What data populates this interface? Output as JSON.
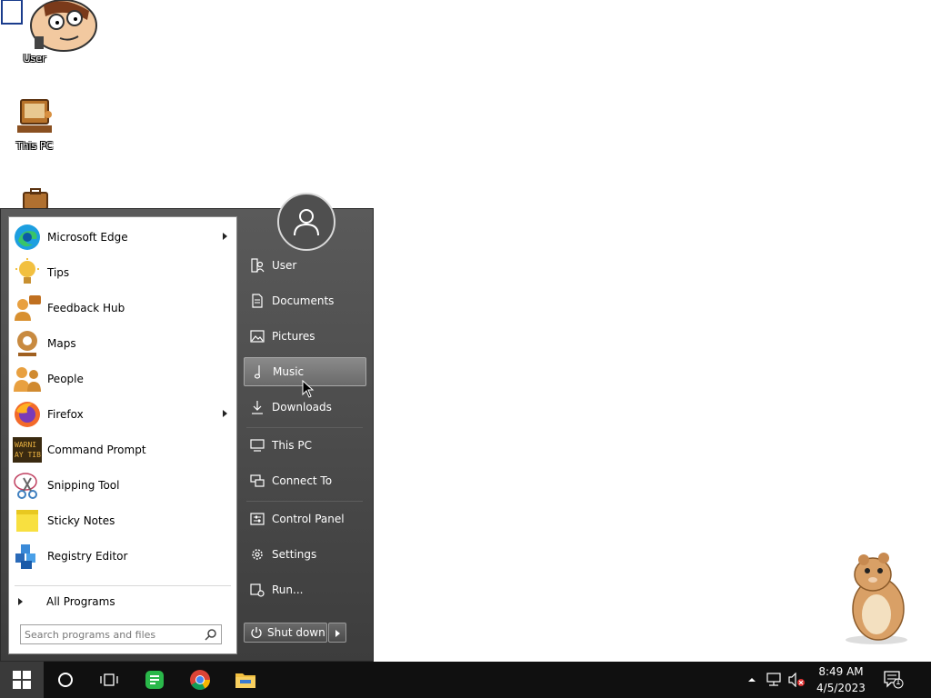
{
  "desktop": {
    "icons": [
      {
        "label": "User",
        "icon": "user-cartoon-icon"
      },
      {
        "label": "This PC",
        "icon": "computer-icon"
      },
      {
        "label": "",
        "icon": "briefcase-icon"
      }
    ]
  },
  "start_menu": {
    "programs": [
      {
        "label": "Microsoft Edge",
        "icon": "edge-icon",
        "submenu": true
      },
      {
        "label": "Tips",
        "icon": "lightbulb-icon",
        "submenu": false
      },
      {
        "label": "Feedback Hub",
        "icon": "feedback-icon",
        "submenu": false
      },
      {
        "label": "Maps",
        "icon": "maps-icon",
        "submenu": false
      },
      {
        "label": "People",
        "icon": "people-icon",
        "submenu": false
      },
      {
        "label": "Firefox",
        "icon": "firefox-icon",
        "submenu": true
      },
      {
        "label": "Command Prompt",
        "icon": "command-prompt-icon",
        "submenu": false
      },
      {
        "label": "Snipping Tool",
        "icon": "scissors-icon",
        "submenu": false
      },
      {
        "label": "Sticky Notes",
        "icon": "sticky-note-icon",
        "submenu": false
      },
      {
        "label": "Registry Editor",
        "icon": "registry-icon",
        "submenu": false
      }
    ],
    "all_programs_label": "All Programs",
    "search_placeholder": "Search programs and files",
    "places": [
      {
        "label": "User",
        "icon": "user-folder-icon"
      },
      {
        "label": "Documents",
        "icon": "document-icon"
      },
      {
        "label": "Pictures",
        "icon": "picture-icon"
      },
      {
        "label": "Music",
        "icon": "music-note-icon",
        "hover": true
      },
      {
        "label": "Downloads",
        "icon": "download-icon"
      },
      {
        "label": "This PC",
        "icon": "monitor-icon"
      },
      {
        "label": "Connect To",
        "icon": "connect-icon"
      },
      {
        "label": "Control Panel",
        "icon": "control-panel-icon"
      },
      {
        "label": "Settings",
        "icon": "gear-icon"
      },
      {
        "label": "Run...",
        "icon": "run-icon"
      }
    ],
    "shutdown_label": "Shut down"
  },
  "taskbar": {
    "pinned": [
      "windows-start-icon",
      "cortana-circle-icon",
      "task-view-icon",
      "green-app-icon",
      "chrome-icon",
      "file-explorer-icon"
    ],
    "tray": [
      "chevron-up-icon",
      "network-icon",
      "volume-muted-icon"
    ],
    "time": "8:49 AM",
    "date": "4/5/2023",
    "notifications_count": "1"
  },
  "colors": {
    "menu_bg": "#4a4a4a",
    "taskbar_bg": "#101010",
    "highlight": "#7a7a7a"
  }
}
